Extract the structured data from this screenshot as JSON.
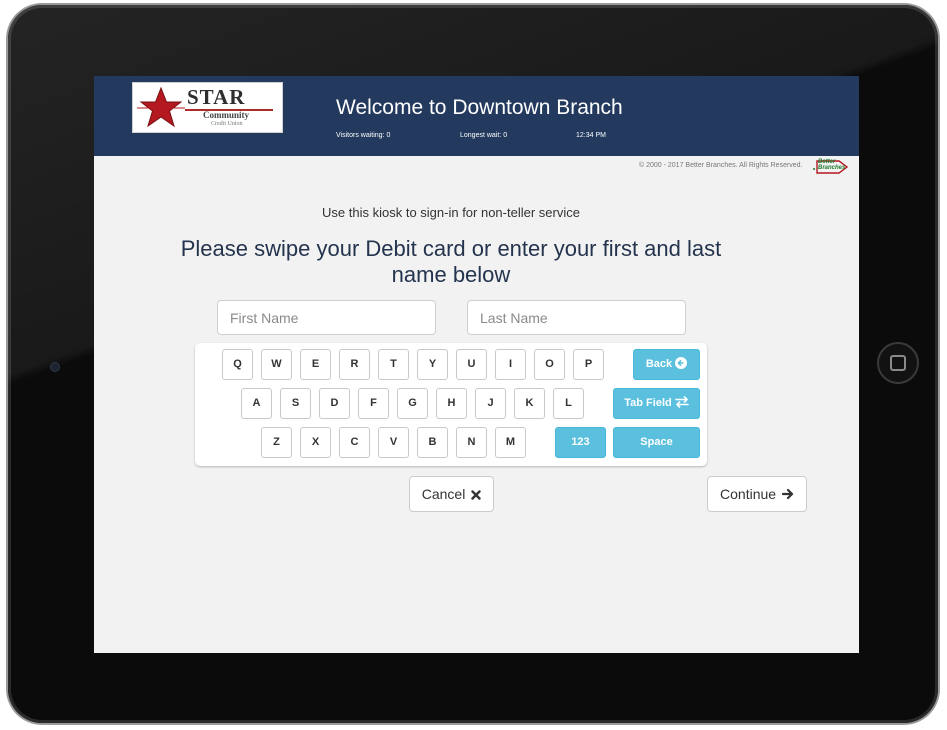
{
  "header": {
    "logo": {
      "name": "STAR",
      "subtitle": "Community",
      "tagline": "Credit Union"
    },
    "welcome": "Welcome to Downtown Branch",
    "stats": {
      "visitors_waiting": "Visitors waiting: 0",
      "longest_wait": "Longest wait: 0",
      "time": "12:34 PM"
    }
  },
  "copyright": "© 2000 - 2017 Better Branches. All Rights Reserved.",
  "vendor_logo": {
    "line1": "Better",
    "line2": "Branches"
  },
  "main": {
    "instruction": "Use this kiosk to sign-in for non-teller service",
    "prompt": "Please swipe your Debit card or enter your first and last name below",
    "first_name_placeholder": "First Name",
    "last_name_placeholder": "Last Name",
    "first_name_value": "",
    "last_name_value": ""
  },
  "keyboard": {
    "row1": [
      "Q",
      "W",
      "E",
      "R",
      "T",
      "Y",
      "U",
      "I",
      "O",
      "P"
    ],
    "row2": [
      "A",
      "S",
      "D",
      "F",
      "G",
      "H",
      "J",
      "K",
      "L"
    ],
    "row3": [
      "Z",
      "X",
      "C",
      "V",
      "B",
      "N",
      "M"
    ],
    "back_label": "Back",
    "tab_label": "Tab Field",
    "numbers_label": "123",
    "space_label": "Space"
  },
  "buttons": {
    "cancel_label": "Cancel",
    "continue_label": "Continue"
  },
  "colors": {
    "header_bg": "#233a5e",
    "accent": "#5bc0de",
    "screen_bg": "#f2f2f2"
  },
  "icons": {
    "back": "circle-arrow-left-icon",
    "tab": "swap-arrows-icon",
    "cancel": "close-icon",
    "continue": "arrow-right-icon"
  }
}
